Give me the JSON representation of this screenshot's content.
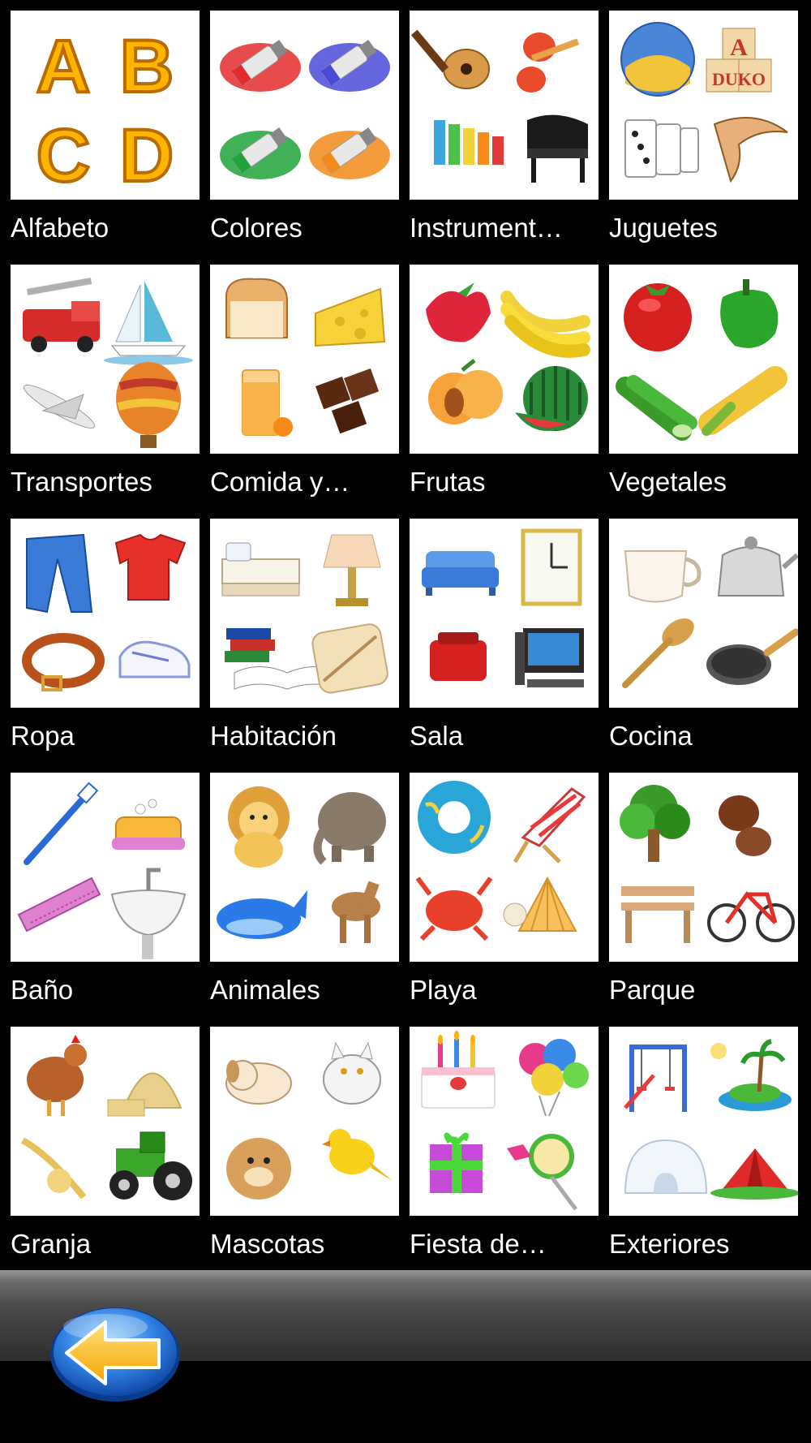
{
  "categories": [
    {
      "label": "Alfabeto",
      "icon": "alphabet-letters-icon"
    },
    {
      "label": "Colores",
      "icon": "paint-tubes-icon"
    },
    {
      "label": "Instrument…",
      "icon": "instruments-icon"
    },
    {
      "label": "Juguetes",
      "icon": "toys-icon"
    },
    {
      "label": "Transportes",
      "icon": "vehicles-icon"
    },
    {
      "label": "Comida y…",
      "icon": "food-icon"
    },
    {
      "label": "Frutas",
      "icon": "fruits-icon"
    },
    {
      "label": "Vegetales",
      "icon": "vegetables-icon"
    },
    {
      "label": "Ropa",
      "icon": "clothes-icon"
    },
    {
      "label": "Habitación",
      "icon": "bedroom-icon"
    },
    {
      "label": "Sala",
      "icon": "living-room-icon"
    },
    {
      "label": "Cocina",
      "icon": "kitchen-icon"
    },
    {
      "label": "Baño",
      "icon": "bathroom-icon"
    },
    {
      "label": "Animales",
      "icon": "animals-icon"
    },
    {
      "label": "Playa",
      "icon": "beach-icon"
    },
    {
      "label": "Parque",
      "icon": "park-icon"
    },
    {
      "label": "Granja",
      "icon": "farm-icon"
    },
    {
      "label": "Mascotas",
      "icon": "pets-icon"
    },
    {
      "label": "Fiesta de…",
      "icon": "party-icon"
    },
    {
      "label": "Exteriores",
      "icon": "outdoors-icon"
    }
  ],
  "alphabet_letters": [
    "A",
    "B",
    "C",
    "D"
  ],
  "blocks_letters": [
    "A",
    "DUKO"
  ],
  "back_button": {
    "icon": "back-arrow-icon"
  },
  "colors": {
    "background": "#000000",
    "tile": "#ffffff",
    "label_text": "#ffffff",
    "back_button_blue": "#2f7fe0",
    "back_arrow_yellow": "#ffc21a"
  }
}
